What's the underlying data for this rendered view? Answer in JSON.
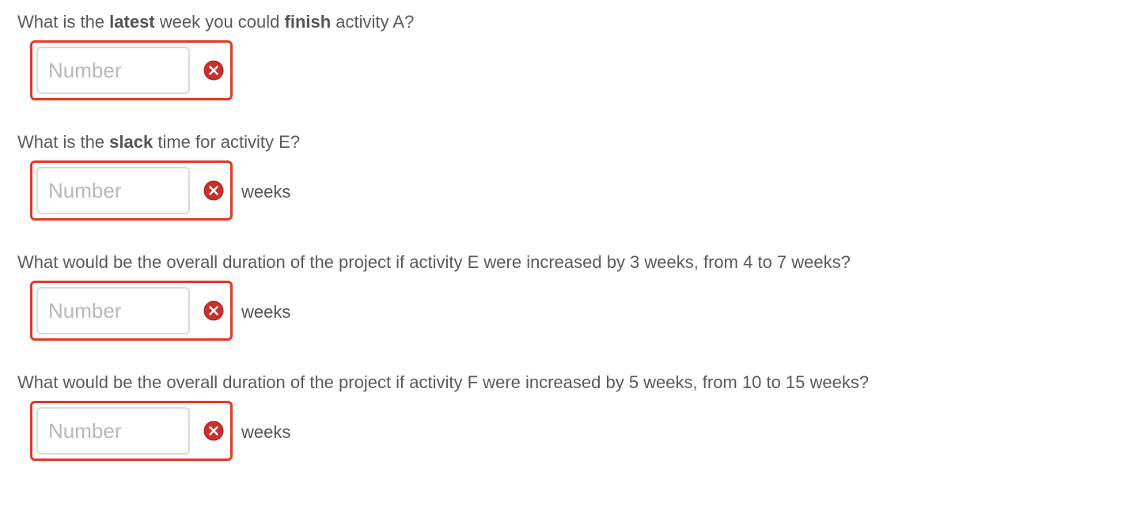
{
  "questions": [
    {
      "parts": [
        "What is the ",
        "latest",
        " week you could ",
        "finish",
        " activity A?"
      ],
      "placeholder": "Number",
      "value": "",
      "unit": ""
    },
    {
      "parts": [
        "What is the ",
        "slack",
        " time for activity E?",
        "",
        ""
      ],
      "placeholder": "Number",
      "value": "",
      "unit": "weeks"
    },
    {
      "parts": [
        "What would be the overall duration of the project if activity E were increased by 3 weeks, from 4 to 7 weeks?",
        "",
        "",
        "",
        ""
      ],
      "placeholder": "Number",
      "value": "",
      "unit": "weeks"
    },
    {
      "parts": [
        "What would be the overall duration of the project if activity F were increased by 5 weeks, from 10 to 15 weeks?",
        "",
        "",
        "",
        ""
      ],
      "placeholder": "Number",
      "value": "",
      "unit": "weeks"
    }
  ],
  "status": {
    "error_icon": "x-circle-icon",
    "error_color": "#c9302c",
    "invalid_border_color": "#e03a22"
  }
}
